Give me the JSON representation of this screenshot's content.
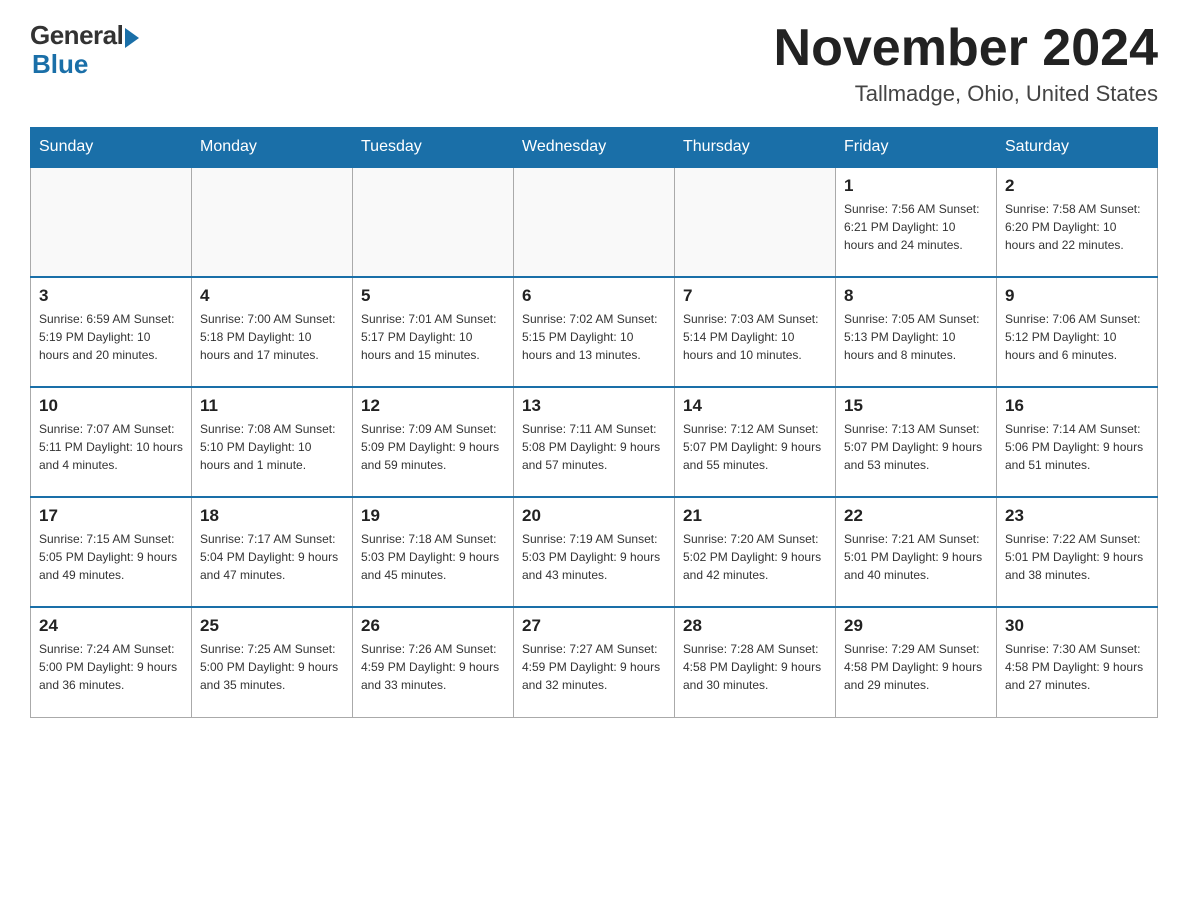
{
  "logo": {
    "general": "General",
    "blue": "Blue"
  },
  "title": {
    "month": "November 2024",
    "location": "Tallmadge, Ohio, United States"
  },
  "days_of_week": [
    "Sunday",
    "Monday",
    "Tuesday",
    "Wednesday",
    "Thursday",
    "Friday",
    "Saturday"
  ],
  "weeks": [
    [
      {
        "day": "",
        "info": ""
      },
      {
        "day": "",
        "info": ""
      },
      {
        "day": "",
        "info": ""
      },
      {
        "day": "",
        "info": ""
      },
      {
        "day": "",
        "info": ""
      },
      {
        "day": "1",
        "info": "Sunrise: 7:56 AM\nSunset: 6:21 PM\nDaylight: 10 hours and 24 minutes."
      },
      {
        "day": "2",
        "info": "Sunrise: 7:58 AM\nSunset: 6:20 PM\nDaylight: 10 hours and 22 minutes."
      }
    ],
    [
      {
        "day": "3",
        "info": "Sunrise: 6:59 AM\nSunset: 5:19 PM\nDaylight: 10 hours and 20 minutes."
      },
      {
        "day": "4",
        "info": "Sunrise: 7:00 AM\nSunset: 5:18 PM\nDaylight: 10 hours and 17 minutes."
      },
      {
        "day": "5",
        "info": "Sunrise: 7:01 AM\nSunset: 5:17 PM\nDaylight: 10 hours and 15 minutes."
      },
      {
        "day": "6",
        "info": "Sunrise: 7:02 AM\nSunset: 5:15 PM\nDaylight: 10 hours and 13 minutes."
      },
      {
        "day": "7",
        "info": "Sunrise: 7:03 AM\nSunset: 5:14 PM\nDaylight: 10 hours and 10 minutes."
      },
      {
        "day": "8",
        "info": "Sunrise: 7:05 AM\nSunset: 5:13 PM\nDaylight: 10 hours and 8 minutes."
      },
      {
        "day": "9",
        "info": "Sunrise: 7:06 AM\nSunset: 5:12 PM\nDaylight: 10 hours and 6 minutes."
      }
    ],
    [
      {
        "day": "10",
        "info": "Sunrise: 7:07 AM\nSunset: 5:11 PM\nDaylight: 10 hours and 4 minutes."
      },
      {
        "day": "11",
        "info": "Sunrise: 7:08 AM\nSunset: 5:10 PM\nDaylight: 10 hours and 1 minute."
      },
      {
        "day": "12",
        "info": "Sunrise: 7:09 AM\nSunset: 5:09 PM\nDaylight: 9 hours and 59 minutes."
      },
      {
        "day": "13",
        "info": "Sunrise: 7:11 AM\nSunset: 5:08 PM\nDaylight: 9 hours and 57 minutes."
      },
      {
        "day": "14",
        "info": "Sunrise: 7:12 AM\nSunset: 5:07 PM\nDaylight: 9 hours and 55 minutes."
      },
      {
        "day": "15",
        "info": "Sunrise: 7:13 AM\nSunset: 5:07 PM\nDaylight: 9 hours and 53 minutes."
      },
      {
        "day": "16",
        "info": "Sunrise: 7:14 AM\nSunset: 5:06 PM\nDaylight: 9 hours and 51 minutes."
      }
    ],
    [
      {
        "day": "17",
        "info": "Sunrise: 7:15 AM\nSunset: 5:05 PM\nDaylight: 9 hours and 49 minutes."
      },
      {
        "day": "18",
        "info": "Sunrise: 7:17 AM\nSunset: 5:04 PM\nDaylight: 9 hours and 47 minutes."
      },
      {
        "day": "19",
        "info": "Sunrise: 7:18 AM\nSunset: 5:03 PM\nDaylight: 9 hours and 45 minutes."
      },
      {
        "day": "20",
        "info": "Sunrise: 7:19 AM\nSunset: 5:03 PM\nDaylight: 9 hours and 43 minutes."
      },
      {
        "day": "21",
        "info": "Sunrise: 7:20 AM\nSunset: 5:02 PM\nDaylight: 9 hours and 42 minutes."
      },
      {
        "day": "22",
        "info": "Sunrise: 7:21 AM\nSunset: 5:01 PM\nDaylight: 9 hours and 40 minutes."
      },
      {
        "day": "23",
        "info": "Sunrise: 7:22 AM\nSunset: 5:01 PM\nDaylight: 9 hours and 38 minutes."
      }
    ],
    [
      {
        "day": "24",
        "info": "Sunrise: 7:24 AM\nSunset: 5:00 PM\nDaylight: 9 hours and 36 minutes."
      },
      {
        "day": "25",
        "info": "Sunrise: 7:25 AM\nSunset: 5:00 PM\nDaylight: 9 hours and 35 minutes."
      },
      {
        "day": "26",
        "info": "Sunrise: 7:26 AM\nSunset: 4:59 PM\nDaylight: 9 hours and 33 minutes."
      },
      {
        "day": "27",
        "info": "Sunrise: 7:27 AM\nSunset: 4:59 PM\nDaylight: 9 hours and 32 minutes."
      },
      {
        "day": "28",
        "info": "Sunrise: 7:28 AM\nSunset: 4:58 PM\nDaylight: 9 hours and 30 minutes."
      },
      {
        "day": "29",
        "info": "Sunrise: 7:29 AM\nSunset: 4:58 PM\nDaylight: 9 hours and 29 minutes."
      },
      {
        "day": "30",
        "info": "Sunrise: 7:30 AM\nSunset: 4:58 PM\nDaylight: 9 hours and 27 minutes."
      }
    ]
  ]
}
